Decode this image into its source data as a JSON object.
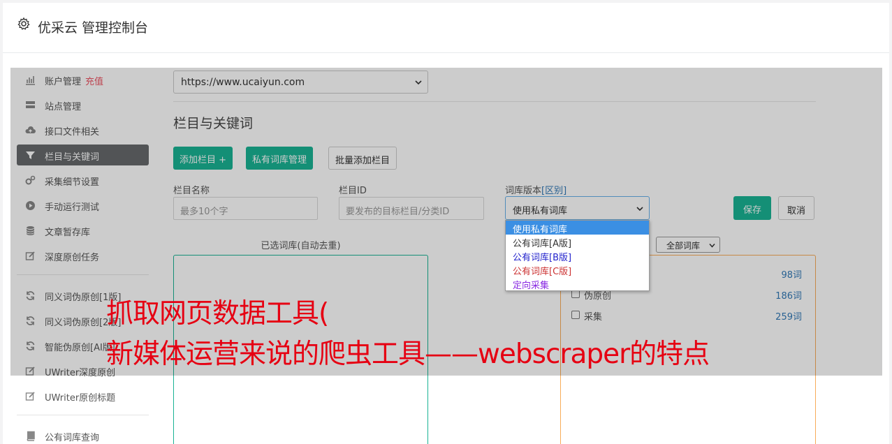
{
  "header": {
    "title": "优采云 管理控制台",
    "icon": "gear-icon"
  },
  "sidebar": {
    "items": [
      {
        "label": "账户管理",
        "extra": "充值",
        "icon": "bar-chart-icon"
      },
      {
        "label": "站点管理",
        "icon": "server-icon"
      },
      {
        "label": "接口文件相关",
        "icon": "cloud-upload-icon"
      },
      {
        "label": "栏目与关键词",
        "icon": "filter-icon",
        "active": true
      },
      {
        "label": "采集细节设置",
        "icon": "cogs-icon"
      },
      {
        "label": "手动运行测试",
        "icon": "play-circle-icon"
      },
      {
        "label": "文章暂存库",
        "icon": "database-icon"
      },
      {
        "label": "深度原创任务",
        "icon": "edit-icon"
      },
      {
        "label": "同义词伪原创[1版]",
        "icon": "refresh-icon"
      },
      {
        "label": "同义词伪原创[2版]",
        "icon": "refresh-icon"
      },
      {
        "label": "智能伪原创[AI版]",
        "icon": "refresh-icon"
      },
      {
        "label": "UWriter深度原创",
        "icon": "edit-icon"
      },
      {
        "label": "UWriter原创标题",
        "icon": "edit-icon"
      },
      {
        "label": "公有词库查询",
        "icon": "book-icon"
      }
    ]
  },
  "main": {
    "site_select": "https://www.ucaiyun.com",
    "section_title": "栏目与关键词",
    "buttons": {
      "add_column": "添加栏目 +",
      "private_lib": "私有词库管理",
      "batch_add": "批量添加栏目",
      "save": "保存",
      "cancel": "取消"
    },
    "form": {
      "name_label": "栏目名称",
      "name_placeholder": "最多10个字",
      "id_label": "栏目ID",
      "id_placeholder": "要发布的目标栏目/分类ID",
      "version_label": "词库版本",
      "version_link": "[区别]",
      "version_value": "使用私有词库"
    },
    "dropdown_options": [
      {
        "label": "使用私有词库",
        "color": "#ffffff",
        "selected": true
      },
      {
        "label": "公有词库[A版]",
        "color": "#333333"
      },
      {
        "label": "公有词库[B版]",
        "color": "#2222cc"
      },
      {
        "label": "公有词库[C版]",
        "color": "#cc3333"
      },
      {
        "label": "定向采集",
        "color": "#8a2be2"
      }
    ],
    "selected_title": "已选词库(自动去重)",
    "filter_select": "全部词库",
    "libraries": [
      {
        "name": "",
        "count": "98词"
      },
      {
        "name": "伪原创",
        "count": "186词"
      },
      {
        "name": "采集",
        "count": "259词"
      }
    ]
  },
  "caption": {
    "line1": "抓取网页数据工具(",
    "line2": "新媒体运营来说的爬虫工具——webscraper的特点"
  }
}
